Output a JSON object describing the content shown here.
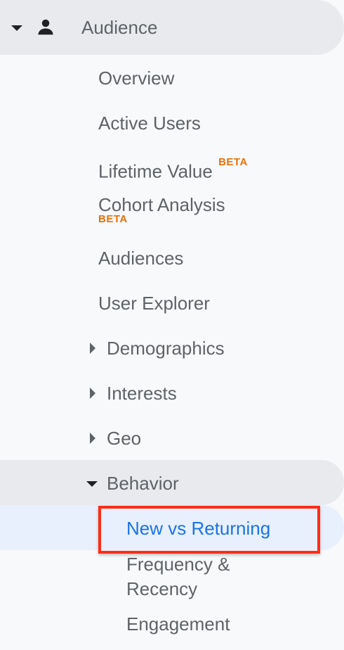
{
  "header": {
    "title": "Audience"
  },
  "items": {
    "overview": "Overview",
    "active_users": "Active Users",
    "lifetime_value": "Lifetime Value",
    "lifetime_value_badge": "BETA",
    "cohort_analysis": "Cohort Analysis",
    "cohort_analysis_badge": "BETA",
    "audiences": "Audiences",
    "user_explorer": "User Explorer",
    "demographics": "Demographics",
    "interests": "Interests",
    "geo": "Geo",
    "behavior": "Behavior"
  },
  "behavior_children": {
    "new_vs_returning": "New vs Returning",
    "frequency_recency_line1": "Frequency &",
    "frequency_recency_line2": "Recency",
    "engagement": "Engagement"
  },
  "colors": {
    "selected_text": "#1a73e8",
    "beta": "#e8710a",
    "highlight_border": "#ff2d17"
  },
  "icons": {
    "header_collapse": "chevron-down-icon",
    "person": "person-icon",
    "demographics_expand": "chevron-right-icon",
    "interests_expand": "chevron-right-icon",
    "geo_expand": "chevron-right-icon",
    "behavior_collapse": "chevron-down-icon"
  }
}
